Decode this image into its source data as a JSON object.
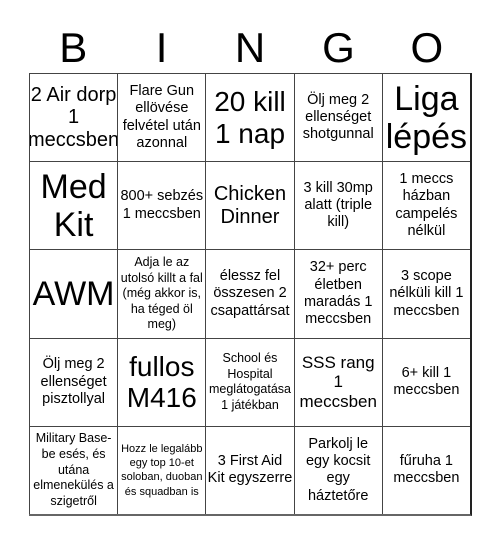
{
  "header": {
    "letters": [
      "B",
      "I",
      "N",
      "G",
      "O"
    ]
  },
  "cells": [
    [
      "2 Air dorp 1 meccsben",
      "Flare Gun ellövése felvétel után azonnal",
      "20 kill 1 nap",
      "Ölj meg 2 ellenséget shotgunnal",
      "Liga lépés"
    ],
    [
      "Med Kit",
      "800+ sebzés 1 meccsben",
      "Chicken Dinner",
      "3 kill 30mp alatt (triple kill)",
      "1 meccs házban campelés nélkül"
    ],
    [
      "AWM",
      "Adja le az utolsó killt a fal (még akkor is, ha téged öl meg)",
      "élessz fel összesen 2 csapattársat",
      "32+ perc életben maradás 1 meccsben",
      "3 scope nélküli kill 1 meccsben"
    ],
    [
      "Ölj meg 2 ellenséget pisztollyal",
      "fullos M416",
      "School és Hospital meglátogatása 1 játékban",
      "SSS rang 1 meccsben",
      "6+ kill 1 meccsben"
    ],
    [
      "Military Base-be esés, és utána elmenekülés a szigetről",
      "Hozz le legalább egy top 10-et soloban, duoban és squadban is",
      "3 First Aid Kit egyszerre",
      "Parkolj le egy kocsit egy háztetőre",
      "fűruha 1 meccsben"
    ]
  ]
}
